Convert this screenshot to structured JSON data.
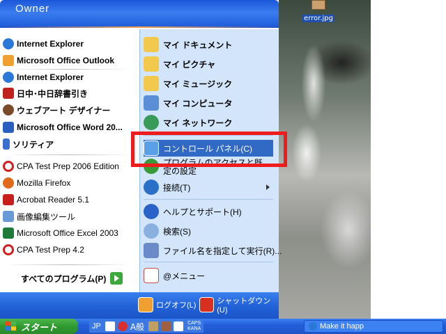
{
  "user": {
    "name": "Owner"
  },
  "desktop": {
    "icon_label": "error.jpg"
  },
  "pinned": [
    {
      "label": "Internet Explorer",
      "icon": "ie-icon",
      "color": "#2a78d8"
    },
    {
      "label": "Microsoft Office Outlook",
      "icon": "outlook-icon",
      "color": "#f0a030"
    }
  ],
  "recent": [
    {
      "label": "Internet Explorer",
      "icon": "ie-icon",
      "color": "#2a78d8"
    },
    {
      "label": "日中･中日辞書引き",
      "icon": "dictionary-icon",
      "color": "#c02020"
    },
    {
      "label": "ウェブアート デザイナー",
      "icon": "web-art-designer-icon",
      "color": "#7a4a2a"
    },
    {
      "label": "Microsoft Office Word 20...",
      "icon": "word-icon",
      "color": "#2b5fbf"
    },
    {
      "label": "ソリティア",
      "icon": "solitaire-icon",
      "color": "#3a6fd0"
    },
    {
      "label": "CPA Test Prep 2006 Edition",
      "icon": "cpa-prep-icon",
      "color": "#d02020"
    },
    {
      "label": "Mozilla Firefox",
      "icon": "firefox-icon",
      "color": "#e06a1a"
    },
    {
      "label": "Acrobat Reader 5.1",
      "icon": "acrobat-icon",
      "color": "#c81e1e"
    },
    {
      "label": "画像編集ツール",
      "icon": "image-edit-icon",
      "color": "#6a9ad8"
    },
    {
      "label": "Microsoft Office Excel 2003",
      "icon": "excel-icon",
      "color": "#1e7a3a"
    },
    {
      "label": "CPA Test Prep 4.2",
      "icon": "cpa-prep-icon",
      "color": "#d02020"
    }
  ],
  "all_programs_label": "すべてのプログラム(P)",
  "places": [
    {
      "label": "マイ ドキュメント",
      "icon": "my-documents-icon",
      "color": "#f2c94c"
    },
    {
      "label": "マイ ピクチャ",
      "icon": "my-pictures-icon",
      "color": "#f2c94c"
    },
    {
      "label": "マイ ミュージック",
      "icon": "my-music-icon",
      "color": "#f2c94c"
    },
    {
      "label": "マイ コンピュータ",
      "icon": "my-computer-icon",
      "color": "#5a8fd8"
    },
    {
      "label": "マイ ネットワーク",
      "icon": "my-network-icon",
      "color": "#3a9a5a"
    }
  ],
  "settings": [
    {
      "label": "コントロール パネル(C)",
      "icon": "control-panel-icon",
      "color": "#5aa0e8"
    },
    {
      "label": "プログラムのアクセスと既定の設定",
      "icon": "program-access-icon",
      "color": "#3a9a3a"
    },
    {
      "label": "接続(T)",
      "icon": "connect-icon",
      "color": "#2a70c8"
    }
  ],
  "help": [
    {
      "label": "ヘルプとサポート(H)",
      "icon": "help-icon",
      "color": "#2a62c8"
    },
    {
      "label": "検索(S)",
      "icon": "search-icon",
      "color": "#8ab0e0"
    },
    {
      "label": "ファイル名を指定して実行(R)...",
      "icon": "run-icon",
      "color": "#6a8ac8"
    }
  ],
  "extra": {
    "label": "@メニュー",
    "icon": "at-menu-icon",
    "color": "#c84a4a"
  },
  "footer": {
    "logoff": "ログオフ(L)",
    "shutdown": "シャットダウン(U)"
  },
  "taskbar": {
    "start_label": "スタート",
    "lang_code": "JP",
    "ime_text": "A般",
    "caps_top": "CAPS",
    "caps_bottom": "KANA",
    "task_label": "Make it happ"
  },
  "colors": {
    "highlight": "#316ac5",
    "annotation": "#ee1c1c",
    "accent": "#245edb"
  }
}
